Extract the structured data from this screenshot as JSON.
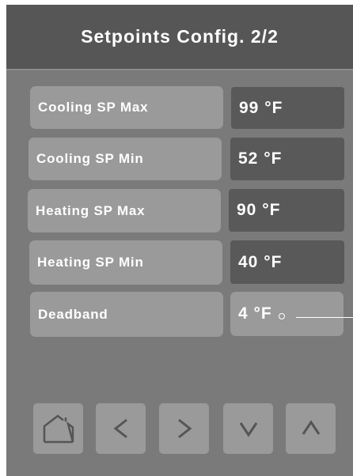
{
  "header": {
    "title": "Setpoints Config. 2/2"
  },
  "rows": [
    {
      "label": "Cooling SP Max",
      "value": "99 °F"
    },
    {
      "label": "Cooling SP Min",
      "value": "52 °F"
    },
    {
      "label": "Heating SP Max",
      "value": "90 °F"
    },
    {
      "label": "Heating SP Min",
      "value": "40 °F"
    },
    {
      "label": "Deadband",
      "value": "4 °F"
    }
  ],
  "nav": {
    "icons": [
      "home-icon",
      "chevron-left-icon",
      "chevron-right-icon",
      "chevron-down-icon",
      "chevron-up-icon"
    ]
  },
  "colors": {
    "screen_bg": "#7a7a7a",
    "title_bg": "#565656",
    "button": "#9a9a9a",
    "value_box": "#595959",
    "icon": "#555555",
    "text": "#ffffff"
  }
}
